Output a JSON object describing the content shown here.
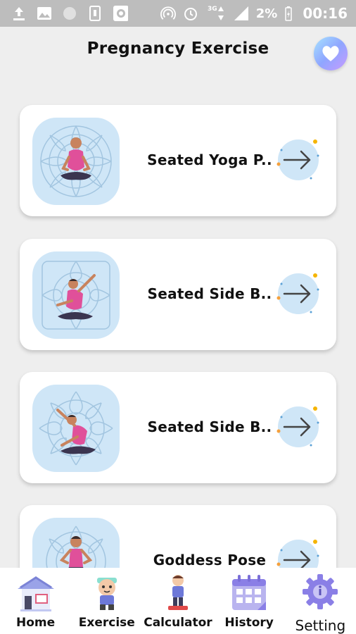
{
  "status_bar": {
    "battery_percent": "2%",
    "time": "00:16",
    "network_label": "3G"
  },
  "header": {
    "title": "Pregnancy Exercise",
    "favorite_icon": "heart-icon"
  },
  "exercises": [
    {
      "label": "Seated Yoga P..",
      "pose": "seated-meditation"
    },
    {
      "label": "Seated Side B..",
      "pose": "side-bend-right"
    },
    {
      "label": "Seated Side B..",
      "pose": "side-bend-left"
    },
    {
      "label": "Goddess Pose",
      "pose": "goddess"
    }
  ],
  "bottom_nav": [
    {
      "label": "Home",
      "icon": "house-icon"
    },
    {
      "label": "Exercise",
      "icon": "exercise-icon"
    },
    {
      "label": "Calculator",
      "icon": "calculator-icon"
    },
    {
      "label": "History",
      "icon": "calendar-icon"
    },
    {
      "label": "Setting",
      "icon": "gear-icon"
    }
  ],
  "colors": {
    "thumb_bg": "#cfe6f7",
    "arrow_bg": "#cfe6f7",
    "accent_pink": "#e0509a",
    "nav_purple": "#8a7fe6"
  }
}
